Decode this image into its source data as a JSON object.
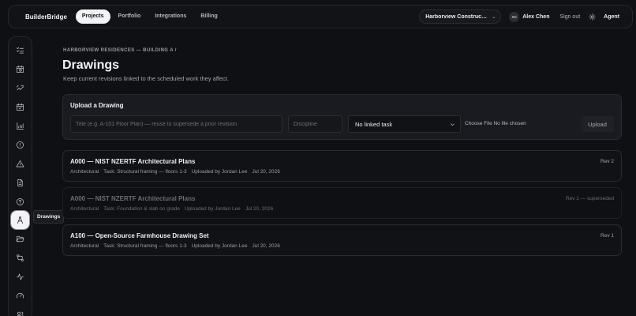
{
  "topbar": {
    "brand": "BuilderBridge",
    "tabs": [
      {
        "label": "Projects",
        "active": true
      },
      {
        "label": "Portfolio",
        "active": false
      },
      {
        "label": "Integrations",
        "active": false
      },
      {
        "label": "Billing",
        "active": false
      }
    ],
    "org_selector": "Harborview Constructi...",
    "avatar_initials": "AC",
    "user_name": "Alex Chen",
    "sign_out": "Sign out",
    "theme_icon": "sun-icon",
    "agent": "Agent"
  },
  "rail": {
    "items": [
      {
        "icon": "list-checks-icon"
      },
      {
        "icon": "calendar-clock-icon"
      },
      {
        "icon": "route-icon"
      },
      {
        "icon": "calendar-check-icon"
      },
      {
        "icon": "chart-bars-icon"
      },
      {
        "icon": "alert-circle-icon"
      },
      {
        "icon": "warning-triangle-icon"
      },
      {
        "icon": "document-icon"
      },
      {
        "icon": "help-circle-icon"
      },
      {
        "icon": "drafting-compass-icon",
        "active": true
      },
      {
        "icon": "folder-open-icon"
      },
      {
        "icon": "swap-icon"
      },
      {
        "icon": "activity-icon"
      },
      {
        "icon": "gauge-icon"
      },
      {
        "icon": "users-icon"
      }
    ],
    "tooltip": "Drawings"
  },
  "breadcrumb": "HARBORVIEW RESIDENCES — BUILDING A  /",
  "page": {
    "title": "Drawings",
    "subtitle": "Keep current revisions linked to the scheduled work they affect."
  },
  "upload": {
    "title": "Upload a Drawing",
    "title_placeholder": "Title (e.g. A-101 Floor Plan) — reuse to supersede a prior revision",
    "discipline_placeholder": "Discipline",
    "task_selected": "No linked task",
    "file_label": "Choose File  No file chosen",
    "button": "Upload"
  },
  "drawings": [
    {
      "title": "A000 — NIST NZERTF Architectural Plans",
      "discipline": "Architectural",
      "task": "Task: Structural framing — floors 1-3",
      "uploaded_by": "Uploaded by Jordan Lee",
      "date": "Jul 20, 2026",
      "revision": "Rev 2",
      "superseded": false
    },
    {
      "title": "A000 — NIST NZERTF Architectural Plans",
      "discipline": "Architectural",
      "task": "Task: Foundation & slab on grade",
      "uploaded_by": "Uploaded by Jordan Lee",
      "date": "Jul 20, 2026",
      "revision": "Rev 1 — superseded",
      "superseded": true
    },
    {
      "title": "A100 — Open-Source Farmhouse Drawing Set",
      "discipline": "Architectural",
      "task": "Task: Structural framing — floors 1-3",
      "uploaded_by": "Uploaded by Jordan Lee",
      "date": "Jul 20, 2026",
      "revision": "Rev 1",
      "superseded": false
    }
  ]
}
